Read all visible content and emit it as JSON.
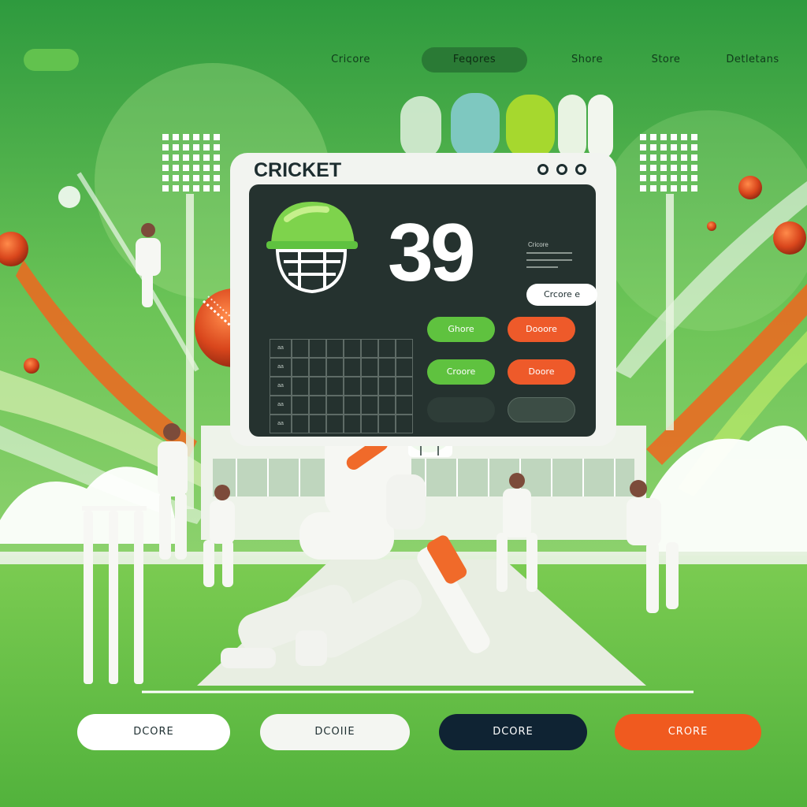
{
  "nav": {
    "items": [
      {
        "label": "Cricore",
        "active": false
      },
      {
        "label": "Feqores",
        "active": true
      },
      {
        "label": "Shore",
        "active": false
      },
      {
        "label": "Store",
        "active": false
      },
      {
        "label": "Detletans",
        "active": false
      }
    ]
  },
  "panel": {
    "title": "CRICKET",
    "score": "39",
    "mini_label": "Cricore",
    "score_pill": "Crcore e",
    "buttons": [
      {
        "label": "Ghore",
        "color": "#5fc23f"
      },
      {
        "label": "Dooore",
        "color": "#ee5a2a"
      },
      {
        "label": "Croore",
        "color": "#5fc23f"
      },
      {
        "label": "Doore",
        "color": "#ee5a2a"
      }
    ],
    "grid_rows": [
      "aa",
      "aa",
      "aa",
      "aa",
      "aa"
    ]
  },
  "bottom_buttons": [
    {
      "label": "DCORE",
      "bg": "#ffffff",
      "fg": "#1d2e30"
    },
    {
      "label": "DCOIIE",
      "bg": "#f4f6f2",
      "fg": "#1d2e30"
    },
    {
      "label": "DCORE",
      "bg": "#0f2333",
      "fg": "#ffffff"
    },
    {
      "label": "CRORE",
      "bg": "#f05a1f",
      "fg": "#ffffff"
    }
  ],
  "colors": {
    "accent_green": "#5fc23f",
    "accent_orange": "#ee5a2a",
    "dark_navy": "#0f2333"
  },
  "icons": [
    "cricket-helmet-icon",
    "cricket-ball-icon",
    "stadium-lights-icon",
    "wicket-stumps-icon"
  ]
}
